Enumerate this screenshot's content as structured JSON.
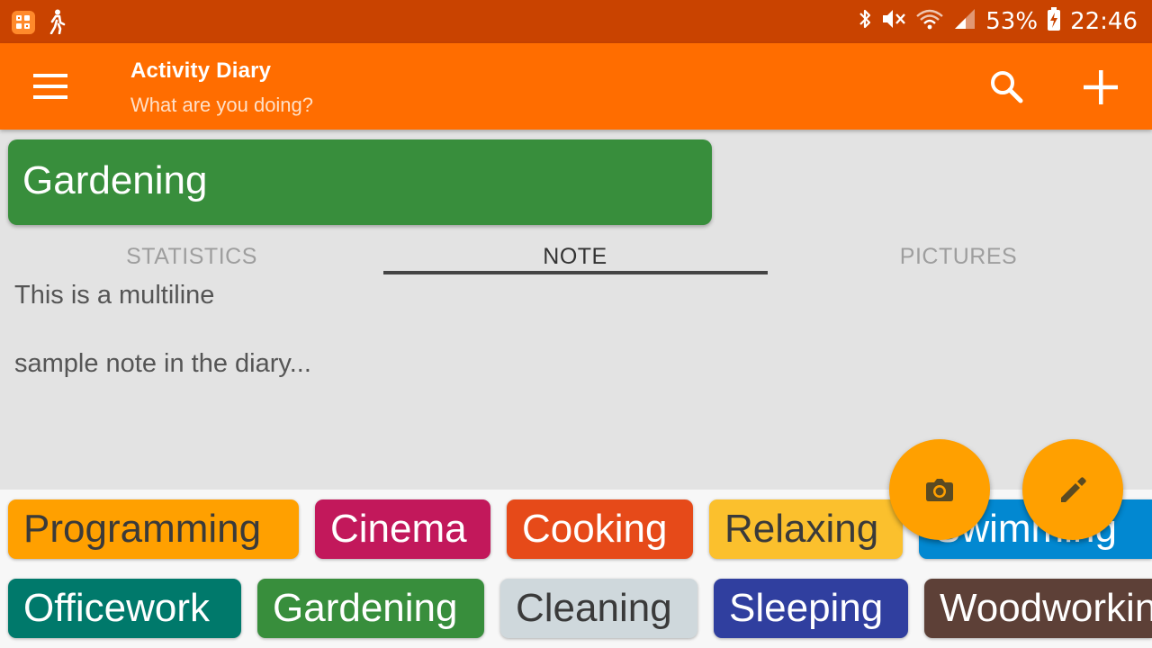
{
  "status_bar": {
    "battery": "53%",
    "time": "22:46",
    "left_icons": [
      "app-launcher-icon",
      "walking-icon"
    ],
    "right_icons": [
      "bluetooth-icon",
      "mute-icon",
      "wifi-icon",
      "signal-icon",
      "battery-charging-icon"
    ]
  },
  "app_bar": {
    "title": "Activity Diary",
    "subtitle": "What are you doing?",
    "icons": [
      "menu-icon",
      "search-icon",
      "add-icon"
    ],
    "color": "#ff6d00"
  },
  "current_activity": {
    "label": "Gardening",
    "color": "#388e3c"
  },
  "tabs": [
    {
      "label": "STATISTICS",
      "active": false
    },
    {
      "label": "NOTE",
      "active": true
    },
    {
      "label": "PICTURES",
      "active": false
    }
  ],
  "note": {
    "line1": "This is a multiline",
    "line2": "sample note in the diary..."
  },
  "fabs": [
    {
      "icon": "camera-icon",
      "color": "#ffa000"
    },
    {
      "icon": "pencil-icon",
      "color": "#ffa000"
    }
  ],
  "activities": [
    {
      "label": "Programming",
      "color": "#ffa000",
      "text_color": "#3a3a3a"
    },
    {
      "label": "Cinema",
      "color": "#c2185b",
      "text_color": "#ffffff"
    },
    {
      "label": "Cooking",
      "color": "#e64a19",
      "text_color": "#ffffff"
    },
    {
      "label": "Relaxing",
      "color": "#fbc02d",
      "text_color": "#3a3a3a"
    },
    {
      "label": "Swimming",
      "color": "#0288d1",
      "text_color": "#ffffff"
    },
    {
      "label": "Officework",
      "color": "#00796b",
      "text_color": "#ffffff"
    },
    {
      "label": "Gardening",
      "color": "#388e3c",
      "text_color": "#ffffff"
    },
    {
      "label": "Cleaning",
      "color": "#cfd8dc",
      "text_color": "#3a3a3a"
    },
    {
      "label": "Sleeping",
      "color": "#303f9f",
      "text_color": "#ffffff"
    },
    {
      "label": "Woodworking",
      "color": "#5d4037",
      "text_color": "#ffffff"
    }
  ]
}
